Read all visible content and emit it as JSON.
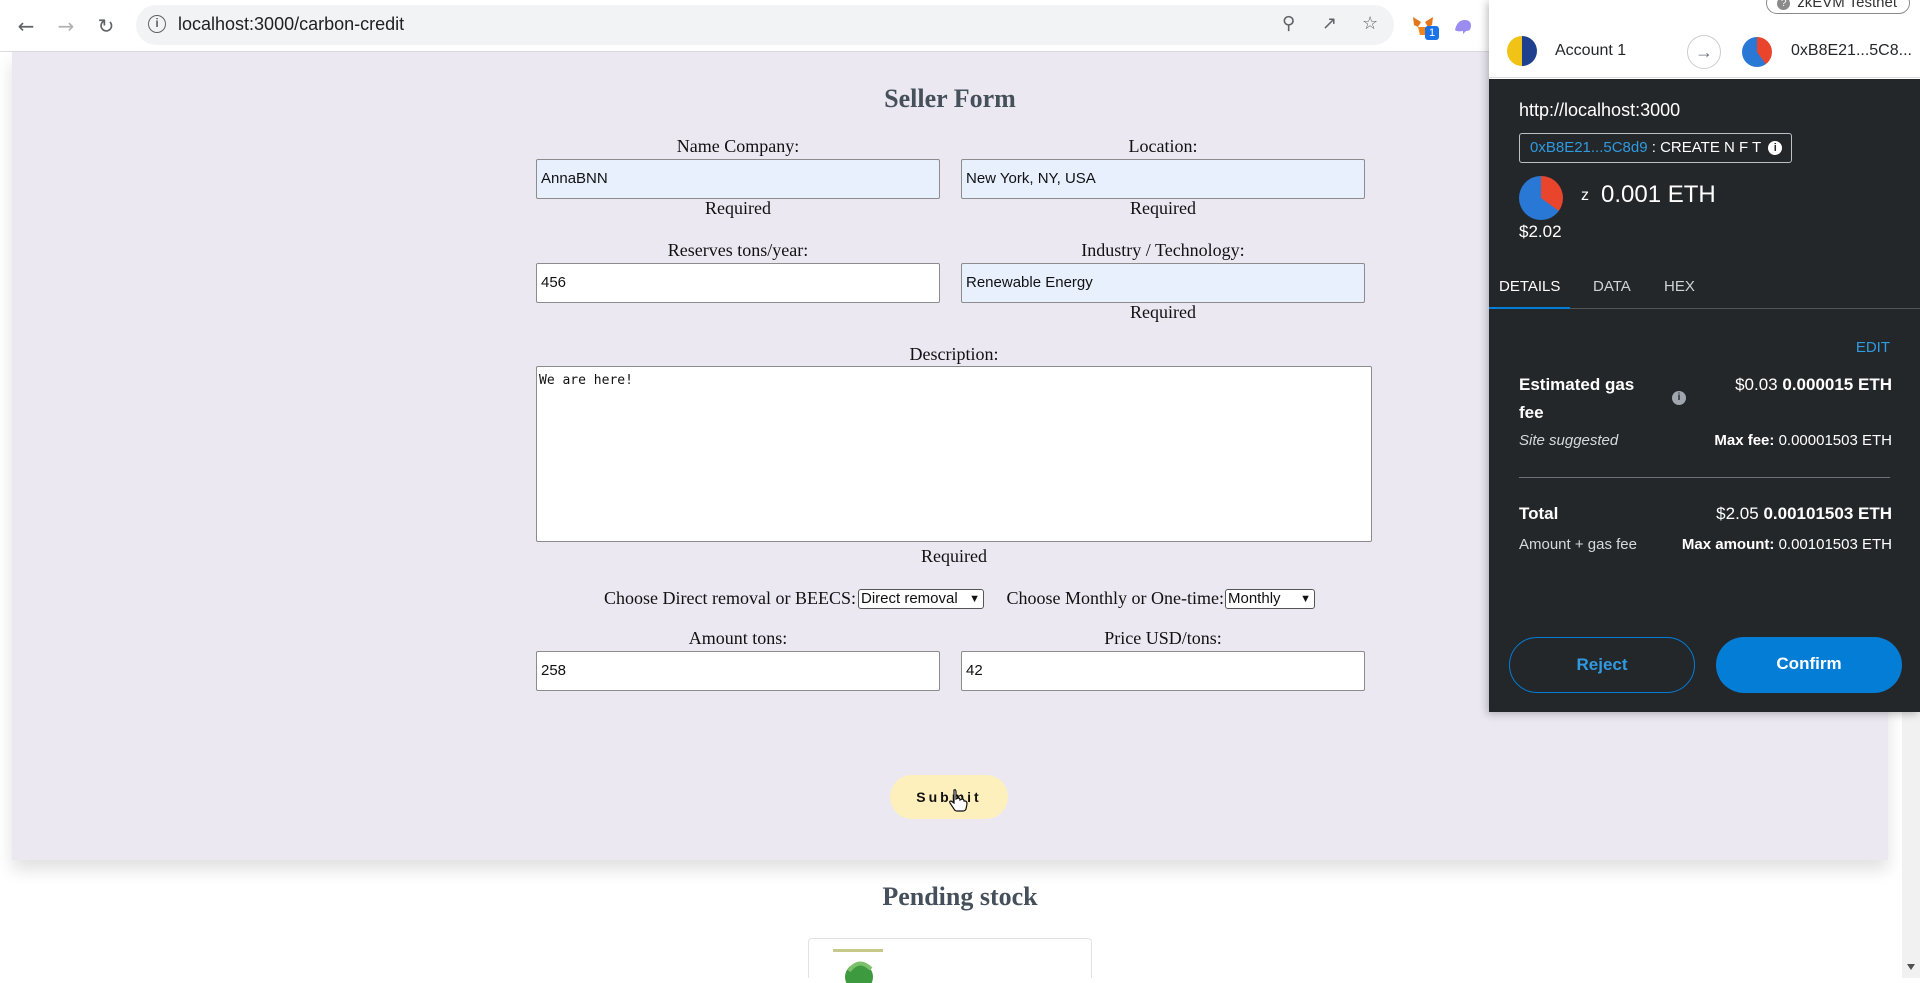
{
  "browser": {
    "url": "localhost:3000/carbon-credit",
    "extension_badge": "1"
  },
  "form": {
    "title": "Seller Form",
    "name_company": {
      "label": "Name Company:",
      "value": "AnnaBNN",
      "helper": "Required"
    },
    "location": {
      "label": "Location:",
      "value": "New York, NY, USA",
      "helper": "Required"
    },
    "reserves": {
      "label": "Reserves tons/year:",
      "value": "456"
    },
    "industry": {
      "label": "Industry / Technology:",
      "value": "Renewable Energy",
      "helper": "Required"
    },
    "description": {
      "label": "Description:",
      "value": "We are here!",
      "helper": "Required"
    },
    "removal_type": {
      "label": "Choose Direct removal or BEECS:",
      "selected": "Direct removal"
    },
    "frequency": {
      "label": "Choose Monthly or One-time:",
      "selected": "Monthly"
    },
    "amount": {
      "label": "Amount tons:",
      "value": "258"
    },
    "price": {
      "label": "Price USD/tons:",
      "value": "42"
    },
    "submit_label": "Submit"
  },
  "pending": {
    "title": "Pending stock"
  },
  "metamask": {
    "network": "zkEVM Testnet",
    "account_name": "Account 1",
    "to_address": "0xB8E21...5C8...",
    "origin": "http://localhost:3000",
    "contract_address": "0xB8E21...5C8d9",
    "method": ": CREATE N F T",
    "token_symbol": "z",
    "amount": "0.001 ETH",
    "amount_usd": "$2.02",
    "tabs": [
      "DETAILS",
      "DATA",
      "HEX"
    ],
    "edit_label": "EDIT",
    "gas_label_line1": "Estimated gas",
    "gas_label_line2": "fee",
    "gas_usd": "$0.03",
    "gas_eth": "0.000015 ETH",
    "site_suggested": "Site suggested",
    "max_fee_label": "Max fee:",
    "max_fee_value": "0.00001503 ETH",
    "total_label": "Total",
    "total_usd": "$2.05",
    "total_eth": "0.00101503 ETH",
    "total_sub": "Amount + gas fee",
    "max_amount_label": "Max amount:",
    "max_amount_value": "0.00101503 ETH",
    "reject_label": "Reject",
    "confirm_label": "Confirm",
    "colors": {
      "accent": "#037dd6",
      "dark_bg": "#24272a"
    }
  }
}
